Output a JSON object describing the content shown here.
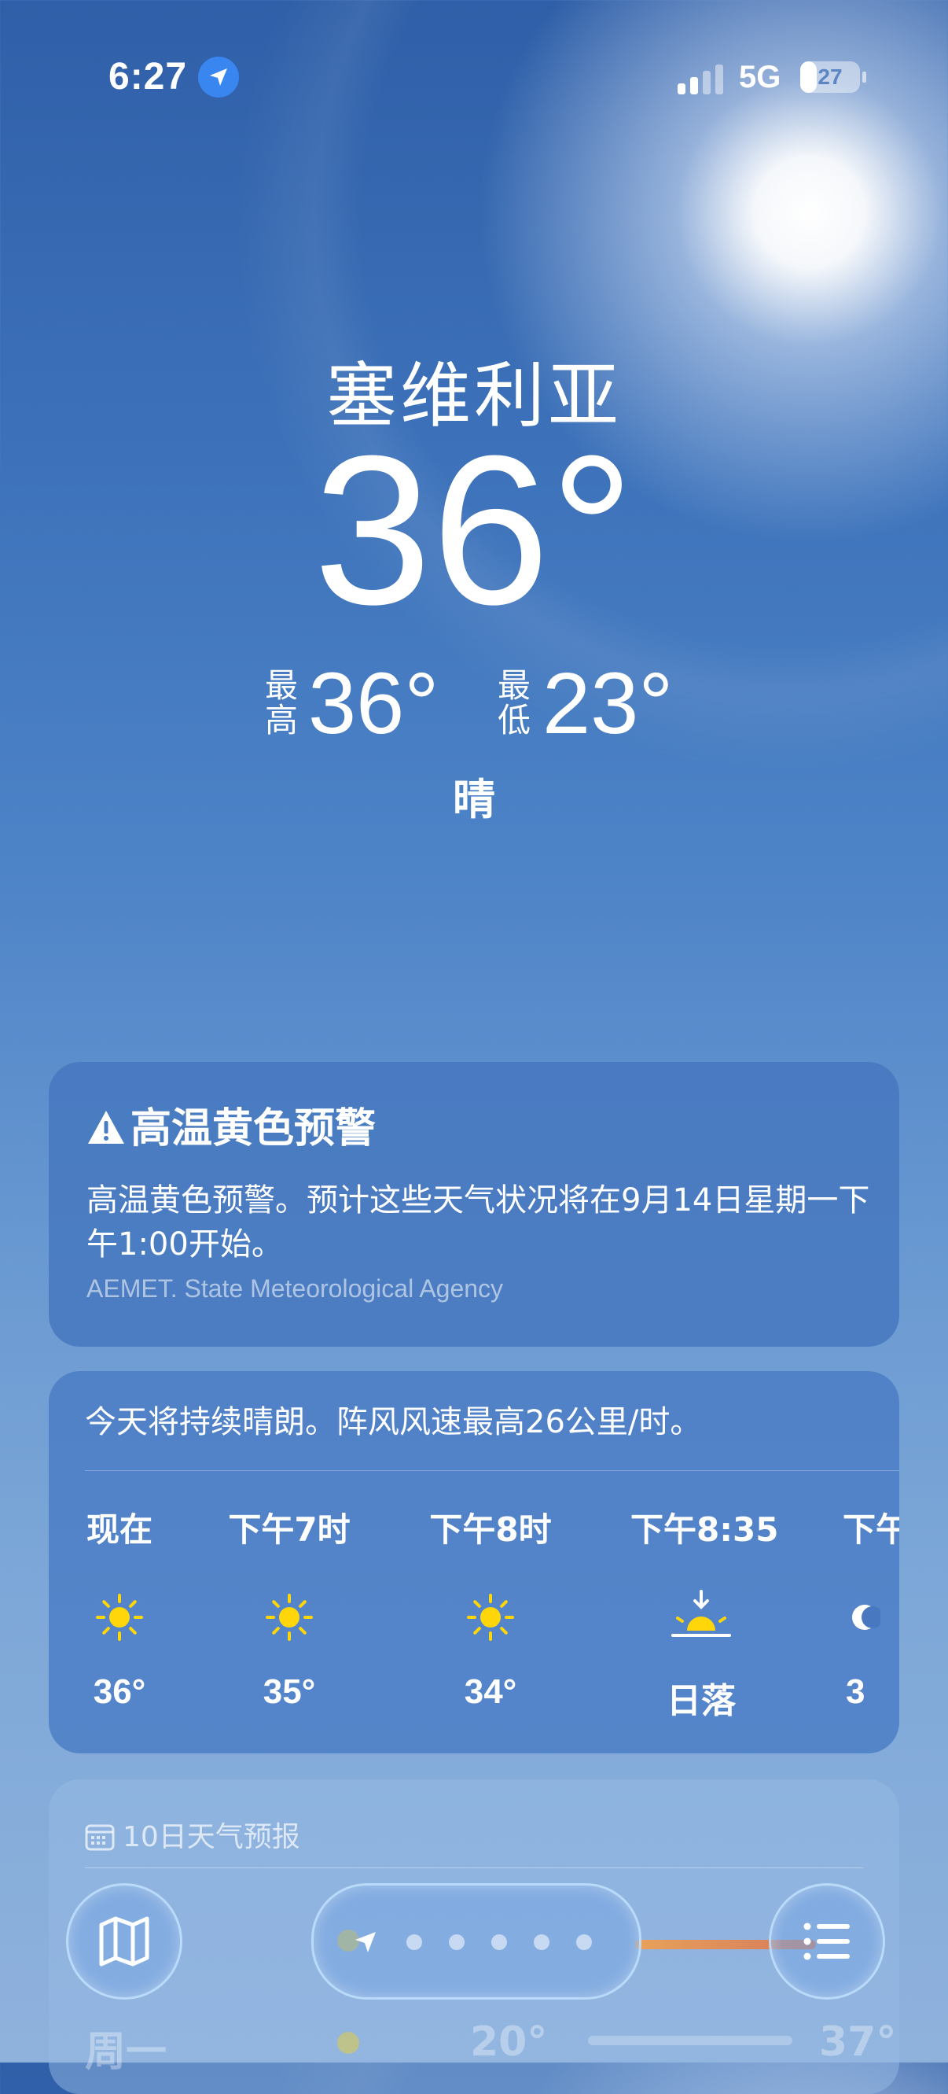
{
  "status_bar": {
    "time": "6:27",
    "network": "5G",
    "battery": "27",
    "battery_level": 0.27
  },
  "location": {
    "city": "塞维利亚",
    "temperature": "36°",
    "high_label": "最高",
    "high": "36°",
    "low_label": "最低",
    "low": "23°",
    "condition": "晴"
  },
  "alert": {
    "title": "高温黄色预警",
    "body": "高温黄色预警。预计这些天气状况将在9月14日星期一下午1:00开始。",
    "source": "AEMET. State Meteorological Agency"
  },
  "hourly": {
    "summary": "今天将持续晴朗。阵风风速最高26公里/时。",
    "items": [
      {
        "time": "现在",
        "icon": "sun-icon",
        "temp": "36°"
      },
      {
        "time": "下午7时",
        "icon": "sun-icon",
        "temp": "35°"
      },
      {
        "time": "下午8时",
        "icon": "sun-icon",
        "temp": "34°"
      },
      {
        "time": "下午8:35",
        "icon": "sunset-icon",
        "temp": "日落"
      },
      {
        "time": "下午",
        "icon": "moon-icon",
        "temp": "3"
      }
    ]
  },
  "ten_day": {
    "title": "10日天气预报",
    "faded_rows": [
      {
        "day": "周一",
        "low": "20°",
        "high": "37°"
      }
    ]
  },
  "bottom_bar": {
    "map_icon": "map-icon",
    "list_icon": "list-icon",
    "location_arrow": "location-arrow-icon",
    "page_count": 5
  },
  "colors": {
    "sun": "#ffd60a",
    "bar_warm": "#e8a15a",
    "accent_blue": "#3a86f0"
  }
}
